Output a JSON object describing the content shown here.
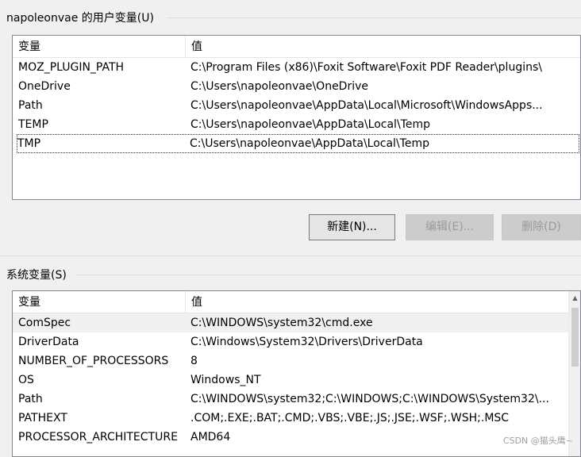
{
  "user_vars": {
    "title": "napoleonvae 的用户变量(U)",
    "col_name": "变量",
    "col_value": "值",
    "rows": [
      {
        "name": "MOZ_PLUGIN_PATH",
        "value": "C:\\Program Files (x86)\\Foxit Software\\Foxit PDF Reader\\plugins\\"
      },
      {
        "name": "OneDrive",
        "value": "C:\\Users\\napoleonvae\\OneDrive"
      },
      {
        "name": "Path",
        "value": "C:\\Users\\napoleonvae\\AppData\\Local\\Microsoft\\WindowsApps..."
      },
      {
        "name": "TEMP",
        "value": "C:\\Users\\napoleonvae\\AppData\\Local\\Temp"
      },
      {
        "name": "TMP",
        "value": "C:\\Users\\napoleonvae\\AppData\\Local\\Temp"
      }
    ],
    "buttons": {
      "new": "新建(N)...",
      "edit": "编辑(E)...",
      "delete": "删除(D)"
    }
  },
  "system_vars": {
    "title": "系统变量(S)",
    "col_name": "变量",
    "col_value": "值",
    "rows": [
      {
        "name": "ComSpec",
        "value": "C:\\WINDOWS\\system32\\cmd.exe"
      },
      {
        "name": "DriverData",
        "value": "C:\\Windows\\System32\\Drivers\\DriverData"
      },
      {
        "name": "NUMBER_OF_PROCESSORS",
        "value": "8"
      },
      {
        "name": "OS",
        "value": "Windows_NT"
      },
      {
        "name": "Path",
        "value": "C:\\WINDOWS\\system32;C:\\WINDOWS;C:\\WINDOWS\\System32\\..."
      },
      {
        "name": "PATHEXT",
        "value": ".COM;.EXE;.BAT;.CMD;.VBS;.VBE;.JS;.JSE;.WSF;.WSH;.MSC"
      },
      {
        "name": "PROCESSOR_ARCHITECTURE",
        "value": "AMD64"
      }
    ]
  },
  "watermark": "CSDN @猫头鹰~"
}
